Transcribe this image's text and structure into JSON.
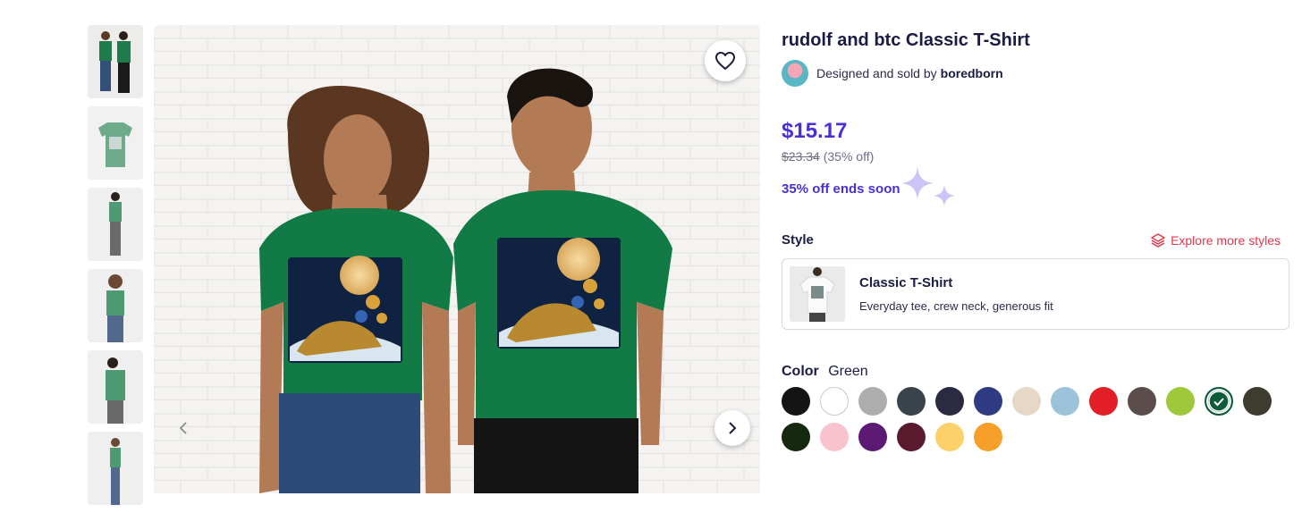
{
  "product": {
    "title": "rudolf and btc Classic T-Shirt",
    "designer_prefix": "Designed and sold by",
    "designer_name": "boredborn",
    "price": "$15.17",
    "old_price": "$23.34",
    "discount": "(35% off)",
    "promo": "35% off ends soon"
  },
  "style": {
    "label": "Style",
    "explore_label": "Explore more styles",
    "name": "Classic T-Shirt",
    "description": "Everyday tee, crew neck, generous fit"
  },
  "color": {
    "label": "Color",
    "selected": "Green",
    "swatches": [
      {
        "name": "Black",
        "hex": "#141414"
      },
      {
        "name": "White",
        "hex": "#ffffff"
      },
      {
        "name": "Heather Grey",
        "hex": "#adadad"
      },
      {
        "name": "Dark Grey",
        "hex": "#38434c"
      },
      {
        "name": "Navy",
        "hex": "#2a2a40"
      },
      {
        "name": "Royal Blue",
        "hex": "#2e3b82"
      },
      {
        "name": "Sand",
        "hex": "#e6d7c6"
      },
      {
        "name": "Light Blue",
        "hex": "#9cc3da"
      },
      {
        "name": "Red",
        "hex": "#e21f26"
      },
      {
        "name": "Brown",
        "hex": "#5b4d4b"
      },
      {
        "name": "Lime",
        "hex": "#9dc93b"
      },
      {
        "name": "Green",
        "hex": "#0e5b3a"
      },
      {
        "name": "Olive",
        "hex": "#3e3b2f"
      },
      {
        "name": "Forest",
        "hex": "#15290f"
      },
      {
        "name": "Pink",
        "hex": "#f8c3ce"
      },
      {
        "name": "Purple",
        "hex": "#5d1a74"
      },
      {
        "name": "Maroon",
        "hex": "#5a1a2e"
      },
      {
        "name": "Gold",
        "hex": "#fcd169"
      },
      {
        "name": "Orange",
        "hex": "#f69f2a"
      }
    ],
    "selected_index": 11
  },
  "icons": {
    "favorite": "heart-icon",
    "next": "chevron-right-icon",
    "prev": "chevron-left-icon",
    "explore": "layers-icon",
    "selected": "check-icon",
    "promo": "sparkle-icon"
  },
  "accent": "#4a2fd4"
}
